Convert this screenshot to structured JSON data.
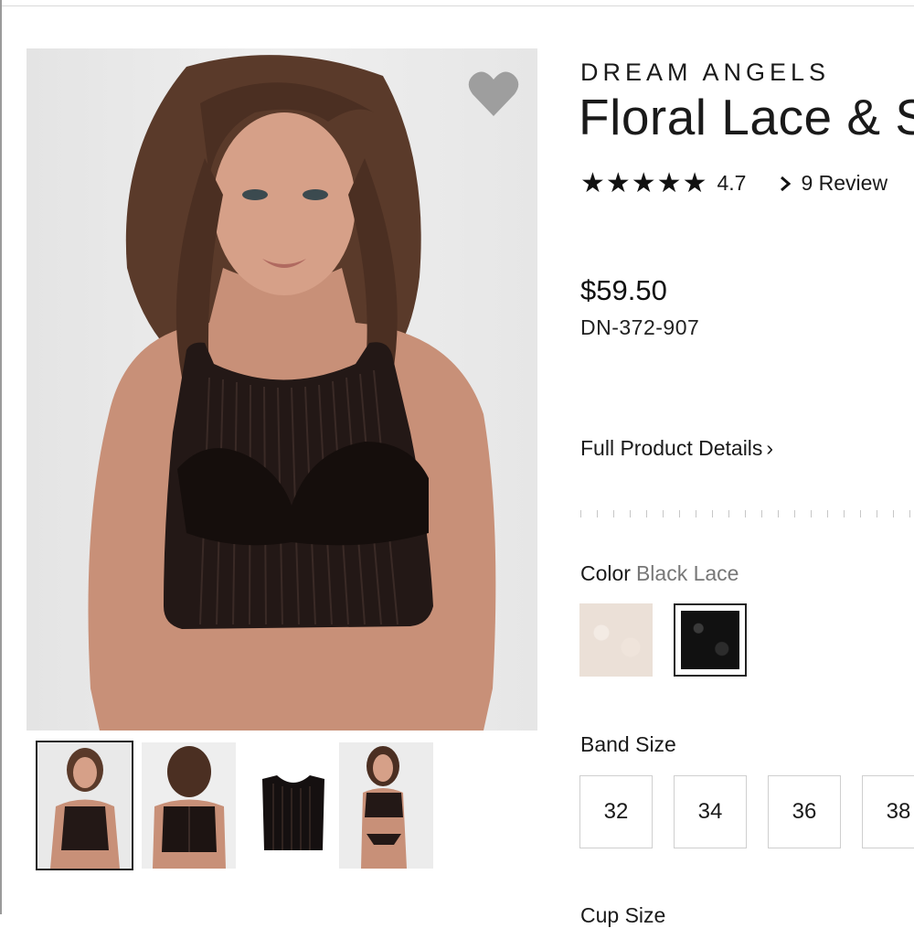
{
  "product": {
    "brand": "DREAM ANGELS",
    "title": "Floral Lace & S",
    "rating_stars": "★★★★★",
    "rating_value": "4.7",
    "reviews_label": "9 Review",
    "price": "$59.50",
    "sku": "DN-372-907",
    "details_label": "Full Product Details",
    "details_chevron": "›"
  },
  "color": {
    "label": "Color",
    "selected": "Black Lace",
    "swatches": [
      "nude-lace",
      "black-lace"
    ]
  },
  "band": {
    "label": "Band Size",
    "sizes": [
      "32",
      "34",
      "36",
      "38"
    ]
  },
  "cup": {
    "label": "Cup Size"
  },
  "icons": {
    "favorite": "heart-icon",
    "reviews": "chevron-right-icon"
  },
  "colors": {
    "heart": "#9e9e9e",
    "text": "#1a1a1a",
    "muted": "#777777"
  }
}
